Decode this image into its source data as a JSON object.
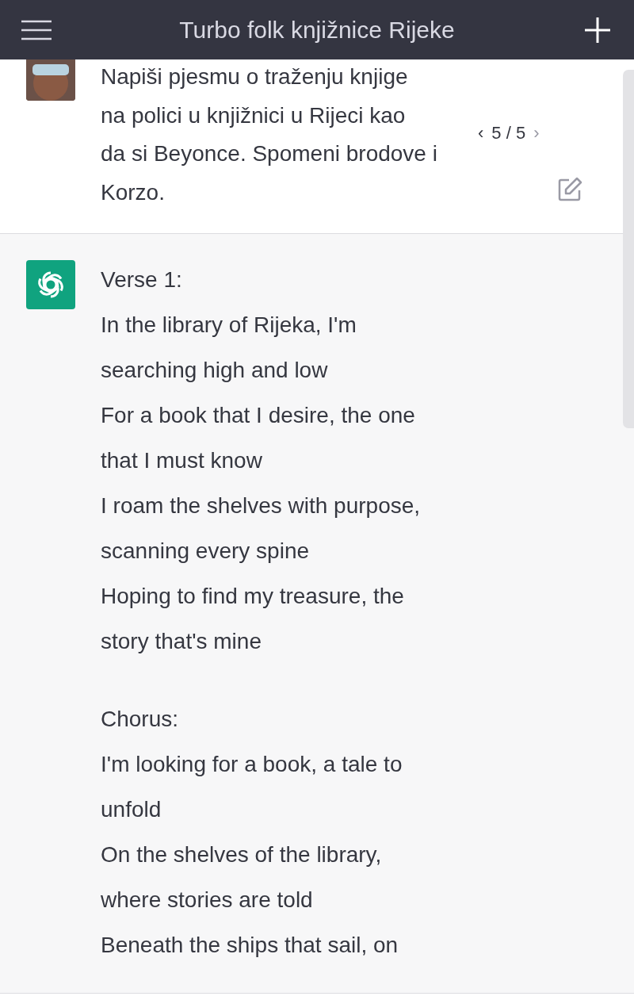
{
  "header": {
    "title": "Turbo folk knjižnice Rijeke"
  },
  "user_message": {
    "lines": [
      "Napiši pjesmu o traženju knjige",
      "na polici u knjižnici u Rijeci kao",
      "da si Beyonce. Spomeni brodove i",
      "Korzo."
    ],
    "pager": {
      "prev": "‹",
      "count": "5 / 5",
      "next": "›"
    }
  },
  "assistant_message": {
    "paragraphs": [
      [
        "Verse 1:",
        "In the library of Rijeka, I'm",
        "searching high and low",
        "For a book that I desire, the one",
        "that I must know",
        "I roam the shelves with purpose,",
        "scanning every spine",
        "Hoping to find my treasure, the",
        "story that's mine"
      ],
      [
        "Chorus:",
        "I'm looking for a book, a tale to",
        "unfold",
        "On the shelves of the library,",
        "where stories are told",
        "Beneath the ships that sail, on"
      ]
    ]
  }
}
